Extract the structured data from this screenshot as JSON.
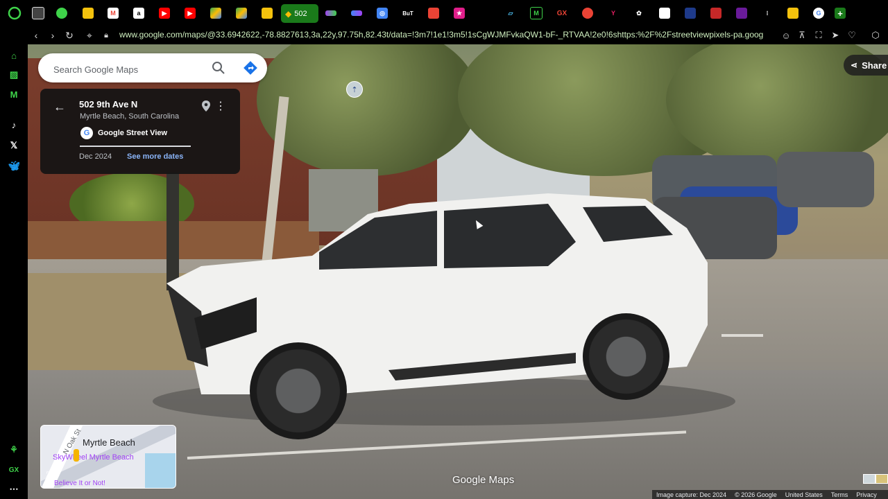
{
  "browser": {
    "active_tab_label": "502",
    "tabs": [
      {
        "icon": "green-circle-icon",
        "color": "#3fd34a"
      },
      {
        "icon": "gmail-icon",
        "color": "#ea4335"
      },
      {
        "icon": "amazon-icon",
        "color": "#ffffff"
      },
      {
        "icon": "youtube-icon",
        "color": "#ff0000"
      },
      {
        "icon": "drive-icon",
        "color": "#34a853"
      },
      {
        "icon": "note-icon",
        "color": "#f4c20d"
      },
      {
        "icon": "tab-icon",
        "color": "#a142f4"
      },
      {
        "icon": "bt-icon",
        "label": "BuT"
      },
      {
        "icon": "gx-icon",
        "label": "GX"
      },
      {
        "icon": "google-icon",
        "color": "#4285f4"
      }
    ],
    "url": "www.google.com/maps/@33.6942622,-78.8827613,3a,22y,97.75h,82.43t/data=!3m7!1e1!3m5!1sCgWJMFvkaQW1-bF-_RTVAA!2e0!6shttps:%2F%2Fstreetviewpixels-pa.goog"
  },
  "sidebar": {
    "items": [
      "gx-corner-icon",
      "tiktok-icon",
      "x-icon",
      "bluesky-icon"
    ],
    "gx_label": "GX"
  },
  "maps": {
    "search_placeholder": "Search Google Maps",
    "share_label": "Share",
    "info": {
      "address": "502 9th Ave N",
      "city": "Myrtle Beach, South Carolina",
      "source": "Google Street View",
      "date": "Dec 2024",
      "more_dates": "See more dates"
    },
    "minimap": {
      "title": "Myrtle Beach",
      "poi": "SkyWheel Myrtle Beach",
      "poi2": "Believe It or Not!",
      "street": "N Oak St"
    },
    "logo": "Google Maps",
    "footer": {
      "capture": "Image capture: Dec 2024",
      "copyright": "© 2026 Google",
      "region": "United States",
      "terms": "Terms",
      "privacy": "Privacy"
    }
  }
}
